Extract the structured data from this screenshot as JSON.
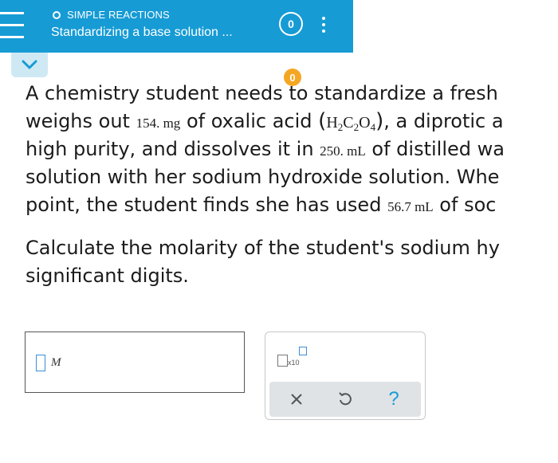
{
  "header": {
    "status_label": "SIMPLE REACTIONS",
    "title": "Standardizing a base solution ...",
    "progress_count": "0",
    "menu_icon": "hamburger-menu-icon",
    "more_icon": "more-vertical-icon",
    "bg_color": "#169bd5"
  },
  "marker": {
    "value": "0",
    "color": "#f5a623"
  },
  "problem": {
    "line1": "A chemistry student needs to standardize a fresh",
    "line2_a": "weighs out ",
    "mass": "154. mg",
    "line2_b": " of oxalic acid ",
    "formula_open": "(",
    "formula_H": "H",
    "formula_H_sub": "2",
    "formula_C": "C",
    "formula_C_sub": "2",
    "formula_O": "O",
    "formula_O_sub": "4",
    "formula_close": ")",
    "line2_c": ", a diprotic a",
    "line3_a": "high purity, and dissolves it in ",
    "volume1": "250. mL",
    "line3_b": " of distilled wa",
    "line4": "solution with her sodium hydroxide solution. Whe",
    "line5_a": "point, the student finds she has used ",
    "volume2": "56.7 mL",
    "line5_b": " of soc"
  },
  "question": {
    "line1": "Calculate the molarity of the student's sodium hy",
    "line2": "significant digits."
  },
  "answer": {
    "value": "",
    "unit": "M"
  },
  "tools": {
    "sci_notation_label": "x10",
    "clear_symbol": "×",
    "help_symbol": "?",
    "accent_color": "#169bd5"
  }
}
